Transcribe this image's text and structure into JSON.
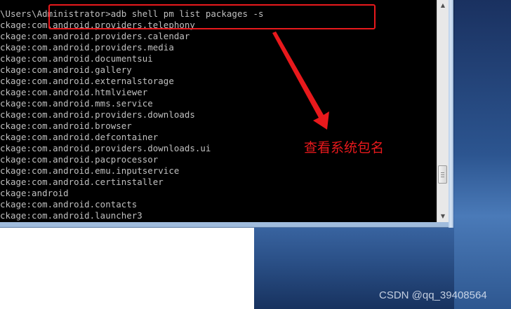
{
  "console": {
    "command_line": "\\Users\\Administrator>adb shell pm list packages -s",
    "lines": [
      "ckage:com.android.providers.telephony",
      "ckage:com.android.providers.calendar",
      "ckage:com.android.providers.media",
      "ckage:com.android.documentsui",
      "ckage:com.android.gallery",
      "ckage:com.android.externalstorage",
      "ckage:com.android.htmlviewer",
      "ckage:com.android.mms.service",
      "ckage:com.android.providers.downloads",
      "ckage:com.android.browser",
      "ckage:com.android.defcontainer",
      "ckage:com.android.providers.downloads.ui",
      "ckage:com.android.pacprocessor",
      "ckage:com.android.emu.inputservice",
      "ckage:com.android.certinstaller",
      "ckage:android",
      "ckage:com.android.contacts",
      "ckage:com.android.launcher3"
    ]
  },
  "scrollbar": {
    "up_icon": "scroll-up-arrow",
    "down_icon": "scroll-down-arrow",
    "up_glyph": "▲",
    "down_glyph": "▼"
  },
  "annotation": {
    "text": "查看系统包名",
    "color": "#e8191c"
  },
  "watermark": {
    "text": "CSDN @qq_39408564"
  }
}
